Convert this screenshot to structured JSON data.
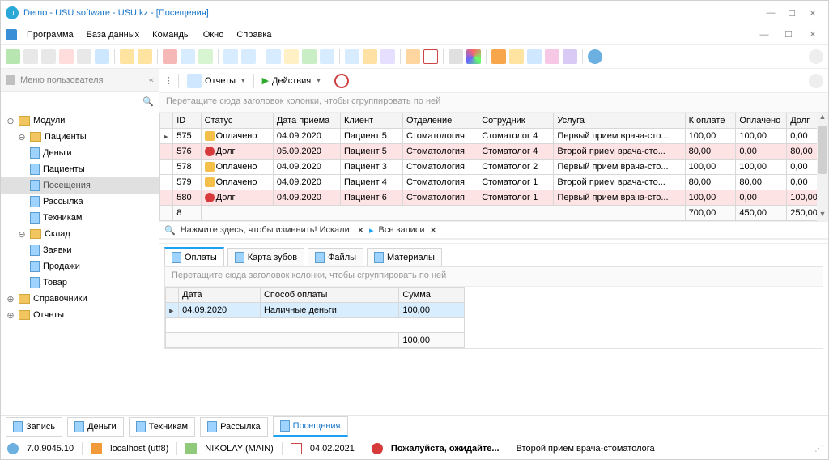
{
  "title": "Demo - USU software - USU.kz - [Посещения]",
  "menu": [
    "Программа",
    "База данных",
    "Команды",
    "Окно",
    "Справка"
  ],
  "sidebar": {
    "header": "Меню пользователя",
    "tree": {
      "modules": "Модули",
      "patients": "Пациенты",
      "money": "Деньги",
      "patients2": "Пациенты",
      "visits": "Посещения",
      "mailing": "Рассылка",
      "tech": "Техникам",
      "stock": "Склад",
      "requests": "Заявки",
      "sales": "Продажи",
      "goods": "Товар",
      "dicts": "Справочники",
      "reports": "Отчеты"
    }
  },
  "maintb": {
    "reports": "Отчеты",
    "actions": "Действия"
  },
  "groupHint": "Перетащите сюда заголовок колонки, чтобы сгруппировать по ней",
  "cols": {
    "id": "ID",
    "status": "Статус",
    "date": "Дата приема",
    "client": "Клиент",
    "dept": "Отделение",
    "emp": "Сотрудник",
    "srv": "Услуга",
    "topay": "К оплате",
    "paid": "Оплачено",
    "debt": "Долг"
  },
  "rows": [
    {
      "id": "575",
      "st": "Оплачено",
      "ok": true,
      "date": "04.09.2020",
      "cl": "Пациент 5",
      "dp": "Стоматология",
      "em": "Стоматолог 4",
      "sv": "Первый прием врача-сто...",
      "tp": "100,00",
      "pd": "100,00",
      "db": "0,00"
    },
    {
      "id": "576",
      "st": "Долг",
      "ok": false,
      "date": "05.09.2020",
      "cl": "Пациент 5",
      "dp": "Стоматология",
      "em": "Стоматолог 4",
      "sv": "Второй прием врача-сто...",
      "tp": "80,00",
      "pd": "0,00",
      "db": "80,00"
    },
    {
      "id": "578",
      "st": "Оплачено",
      "ok": true,
      "date": "04.09.2020",
      "cl": "Пациент 3",
      "dp": "Стоматология",
      "em": "Стоматолог 2",
      "sv": "Первый прием врача-сто...",
      "tp": "100,00",
      "pd": "100,00",
      "db": "0,00"
    },
    {
      "id": "579",
      "st": "Оплачено",
      "ok": true,
      "date": "04.09.2020",
      "cl": "Пациент 4",
      "dp": "Стоматология",
      "em": "Стоматолог 1",
      "sv": "Второй прием врача-сто...",
      "tp": "80,00",
      "pd": "80,00",
      "db": "0,00"
    },
    {
      "id": "580",
      "st": "Долг",
      "ok": false,
      "date": "04.09.2020",
      "cl": "Пациент 6",
      "dp": "Стоматология",
      "em": "Стоматолог 1",
      "sv": "Первый прием врача-сто...",
      "tp": "100,00",
      "pd": "0,00",
      "db": "100,00"
    }
  ],
  "sums": {
    "count": "8",
    "tp": "700,00",
    "pd": "450,00",
    "db": "250,00"
  },
  "filter": {
    "lbl": "Нажмите здесь, чтобы изменить! Искали:",
    "all": "Все записи"
  },
  "dtabs": {
    "pay": "Оплаты",
    "teeth": "Карта зубов",
    "files": "Файлы",
    "mat": "Материалы"
  },
  "dcols": {
    "date": "Дата",
    "method": "Способ оплаты",
    "sum": "Сумма"
  },
  "drow": {
    "date": "04.09.2020",
    "method": "Наличные деньги",
    "sum": "100,00"
  },
  "dsum": "100,00",
  "ftabs": {
    "rec": "Запись",
    "money": "Деньги",
    "tech": "Техникам",
    "mail": "Рассылка",
    "vis": "Посещения"
  },
  "status": {
    "ver": "7.0.9045.10",
    "host": "localhost (utf8)",
    "user": "NIKOLAY (MAIN)",
    "date": "04.02.2021",
    "wait": "Пожалуйста, ожидайте...",
    "srv": "Второй прием врача-стоматолога"
  }
}
